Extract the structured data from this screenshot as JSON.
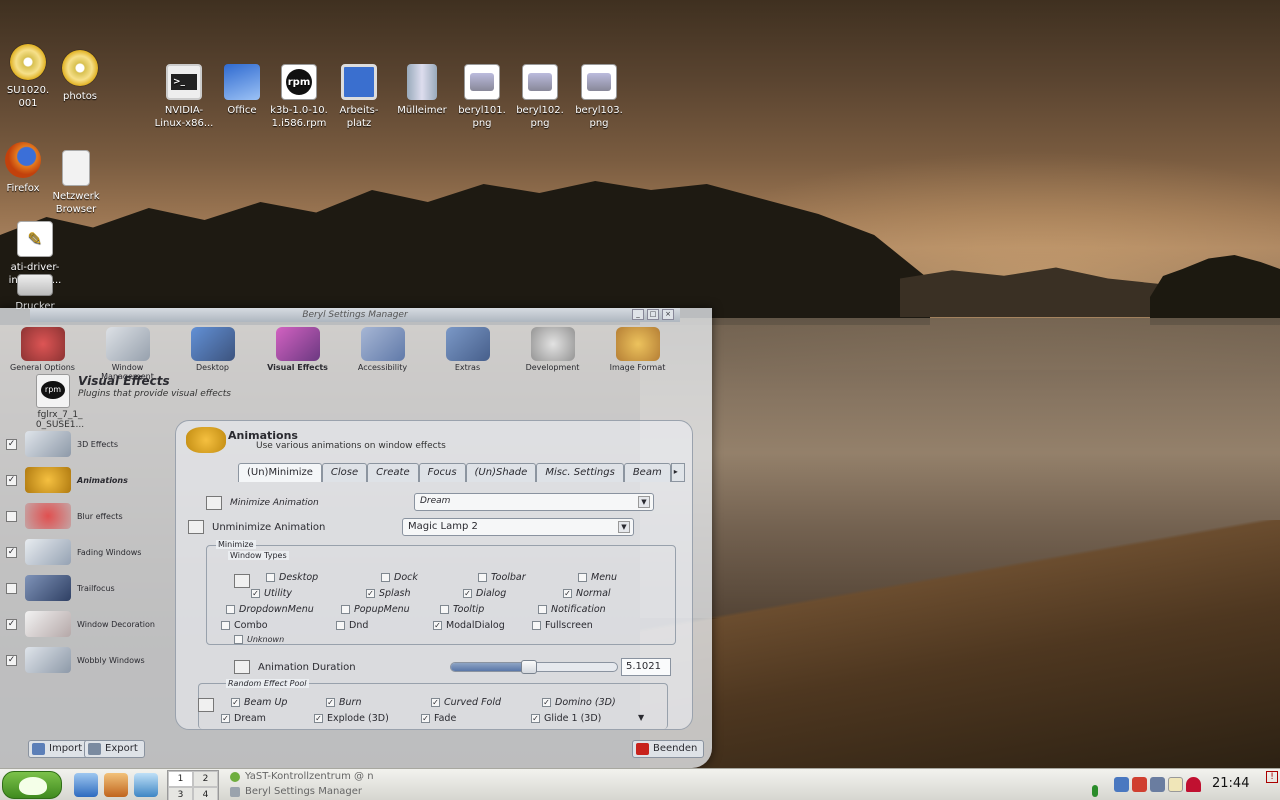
{
  "desktop": {
    "icons": [
      {
        "label": "SU1020.\n001",
        "icon": "cd-icon"
      },
      {
        "label": "photos",
        "icon": "cd-icon"
      },
      {
        "label": "NVIDIA-\nLinux-x86...",
        "icon": "terminal-icon"
      },
      {
        "label": "Office",
        "icon": "office-icon"
      },
      {
        "label": "k3b-1.0-10.\n1.i586.rpm",
        "icon": "rpm-icon"
      },
      {
        "label": "Arbeits-\nplatz",
        "icon": "computer-icon"
      },
      {
        "label": "Mülleimer",
        "icon": "trash-icon"
      },
      {
        "label": "beryl101.\npng",
        "icon": "image-file-icon"
      },
      {
        "label": "beryl102.\npng",
        "icon": "image-file-icon"
      },
      {
        "label": "beryl103.\npng",
        "icon": "image-file-icon"
      },
      {
        "label": "Firefox",
        "icon": "firefox-icon"
      },
      {
        "label": "Netzwerk\nBrowser",
        "icon": "network-icon"
      },
      {
        "label": "ati-driver-\ninstaller-...",
        "icon": "text-file-icon"
      },
      {
        "label": "Drucker",
        "icon": "printer-icon"
      },
      {
        "label": "fglrx_7_1_\n0_SUSE1...",
        "icon": "rpm-icon"
      }
    ]
  },
  "window": {
    "title": "Beryl Settings Manager",
    "categories": [
      {
        "label": "General Options"
      },
      {
        "label": "Window Management"
      },
      {
        "label": "Desktop"
      },
      {
        "label": "Visual Effects"
      },
      {
        "label": "Accessibility"
      },
      {
        "label": "Extras"
      },
      {
        "label": "Development"
      },
      {
        "label": "Image Format"
      }
    ],
    "section_title": "Visual Effects",
    "section_desc": "Plugins that provide visual effects",
    "plugins": [
      {
        "label": "3D Effects",
        "checked": true
      },
      {
        "label": "Animations",
        "checked": true
      },
      {
        "label": "Blur effects",
        "checked": false
      },
      {
        "label": "Fading Windows",
        "checked": true
      },
      {
        "label": "Trailfocus",
        "checked": false
      },
      {
        "label": "Window Decoration",
        "checked": true
      },
      {
        "label": "Wobbly Windows",
        "checked": true
      }
    ],
    "panel": {
      "title": "Animations",
      "desc": "Use various animations on window effects",
      "tabs": [
        "(Un)Minimize",
        "Close",
        "Create",
        "Focus",
        "(Un)Shade",
        "Misc. Settings",
        "Beam"
      ],
      "minimize_label": "Minimize Animation",
      "minimize_value": "Dream",
      "unminimize_label": "Unminimize Animation",
      "unminimize_value": "Magic Lamp 2",
      "minimize_group": "Minimize",
      "window_types_group": "Window Types",
      "window_types": [
        {
          "label": "Desktop",
          "checked": false
        },
        {
          "label": "Dock",
          "checked": false
        },
        {
          "label": "Toolbar",
          "checked": false
        },
        {
          "label": "Menu",
          "checked": false
        },
        {
          "label": "Utility",
          "checked": true
        },
        {
          "label": "Splash",
          "checked": true
        },
        {
          "label": "Dialog",
          "checked": true
        },
        {
          "label": "Normal",
          "checked": true
        },
        {
          "label": "DropdownMenu",
          "checked": false
        },
        {
          "label": "PopupMenu",
          "checked": false
        },
        {
          "label": "Tooltip",
          "checked": false
        },
        {
          "label": "Notification",
          "checked": false
        },
        {
          "label": "Combo",
          "checked": false
        },
        {
          "label": "Dnd",
          "checked": false
        },
        {
          "label": "ModalDialog",
          "checked": true
        },
        {
          "label": "Fullscreen",
          "checked": false
        },
        {
          "label": "Unknown",
          "checked": false
        }
      ],
      "duration_label": "Animation Duration",
      "duration_value": "5.1021",
      "duration_fraction": 0.47,
      "random_pool_group": "Random Effect Pool",
      "random_pool": [
        {
          "label": "Beam Up",
          "checked": true
        },
        {
          "label": "Burn",
          "checked": true
        },
        {
          "label": "Curved Fold",
          "checked": true
        },
        {
          "label": "Domino (3D)",
          "checked": true
        },
        {
          "label": "Dream",
          "checked": true
        },
        {
          "label": "Explode (3D)",
          "checked": true
        },
        {
          "label": "Fade",
          "checked": true
        },
        {
          "label": "Glide 1 (3D)",
          "checked": true
        }
      ]
    },
    "buttons": {
      "import": "Import",
      "export": "Export",
      "close": "Beenden"
    }
  },
  "taskbar": {
    "pager": [
      "1",
      "2",
      "3",
      "4"
    ],
    "tasks": [
      {
        "label": "YaST-Kontrollzentrum @ n"
      },
      {
        "label": "Beryl Settings Manager"
      }
    ],
    "clock": "21:44"
  },
  "colors": {
    "accent": "#3f8a1f",
    "window_bg": "#e8ecf0"
  }
}
